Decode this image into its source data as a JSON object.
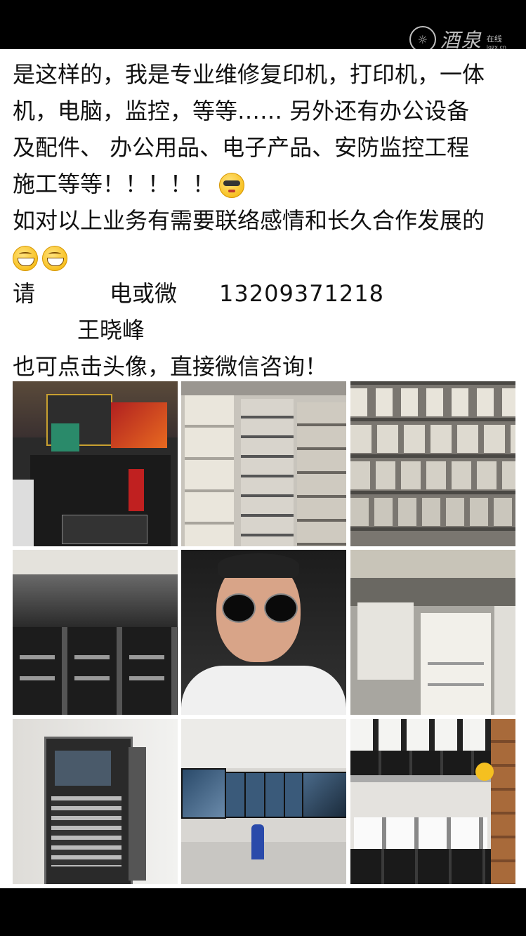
{
  "watermark": {
    "brand": "酒泉",
    "suffix": "在线",
    "url": "jqzx.cn"
  },
  "post": {
    "line1": "是这样的，我是专业维修复印机，打印机，一体",
    "line2": "机，电脑，监控，等等……  另外还有办公设备",
    "line3": "及配件、 办公用品、电子产品、安防监控工程",
    "line4": "施工等等！！！！！",
    "line5": "如对以上业务有需要联络感情和长久合作发展的",
    "contact_prefix": "请",
    "contact_method": "电或微",
    "phone": "13209371218",
    "name": "王晓峰",
    "final_line": "也可点击头像，直接微信咨询！"
  },
  "emojis": {
    "after_line4": "cool-face",
    "after_line5": [
      "grin-face",
      "grin-face"
    ]
  },
  "photos": [
    {
      "name": "photo-computer-parts",
      "subject": "computer parts and cases"
    },
    {
      "name": "photo-projectors-stack",
      "subject": "stacked projectors"
    },
    {
      "name": "photo-printer-shelves",
      "subject": "printers on shelves"
    },
    {
      "name": "photo-wrapped-copiers",
      "subject": "copiers in plastic wrap"
    },
    {
      "name": "photo-portrait",
      "subject": "man with round sunglasses"
    },
    {
      "name": "photo-white-copiers",
      "subject": "white copiers in warehouse"
    },
    {
      "name": "photo-server-rack",
      "subject": "server rack cabinet"
    },
    {
      "name": "photo-monitor-wall",
      "subject": "surveillance monitors"
    },
    {
      "name": "photo-cctv-cameras",
      "subject": "security cameras on shelves"
    }
  ],
  "colors": {
    "background": "#000000",
    "content_bg": "#ffffff",
    "text": "#111111"
  }
}
